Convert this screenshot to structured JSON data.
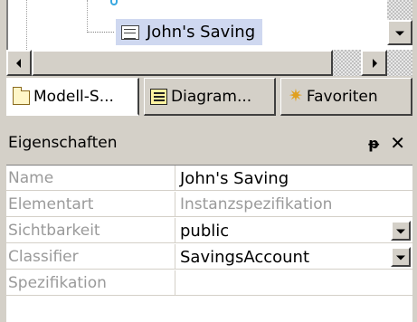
{
  "tree": {
    "selected_item": "John's Saving",
    "icon": "instance-specification-icon"
  },
  "tabs": [
    {
      "label": "Modell-S...",
      "icon": "folder-icon",
      "active": true
    },
    {
      "label": "Diagram...",
      "icon": "diagram-icon",
      "active": false
    },
    {
      "label": "Favoriten",
      "icon": "star-icon",
      "active": false
    }
  ],
  "properties": {
    "title": "Eigenschaften",
    "pin_glyph": "ᵽ",
    "close_glyph": "✕",
    "rows": [
      {
        "name": "Name",
        "value": "John's Saving",
        "disabled": false,
        "dropdown": false
      },
      {
        "name": "Elementart",
        "value": "Instanzspezifikation",
        "disabled": true,
        "dropdown": false
      },
      {
        "name": "Sichtbarkeit",
        "value": "public",
        "disabled": false,
        "dropdown": true
      },
      {
        "name": "Classifier",
        "value": "SavingsAccount",
        "disabled": false,
        "dropdown": true
      },
      {
        "name": "Spezifikation",
        "value": "",
        "disabled": false,
        "dropdown": false
      }
    ]
  },
  "colors": {
    "panel_bg": "#d4d0c8",
    "selection_bg": "#cfd8f0",
    "disabled_text": "#9a9a9a"
  }
}
